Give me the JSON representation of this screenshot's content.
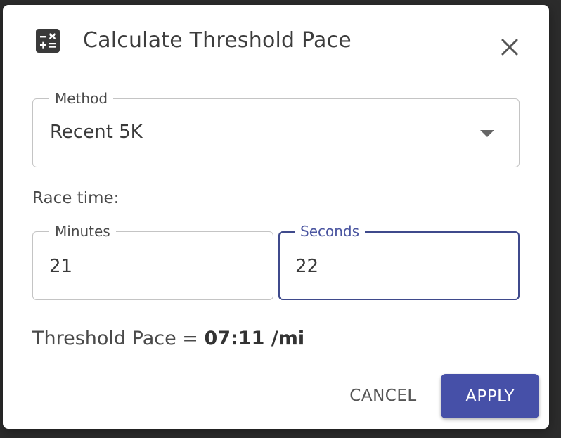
{
  "dialog": {
    "title": "Calculate Threshold Pace",
    "title_icon": "calculator-icon",
    "close_icon": "close-icon"
  },
  "method": {
    "label": "Method",
    "value": "Recent 5K"
  },
  "race_time": {
    "label": "Race time:",
    "minutes": {
      "label": "Minutes",
      "value": "21"
    },
    "seconds": {
      "label": "Seconds",
      "value": "22"
    }
  },
  "result": {
    "prefix": "Threshold Pace = ",
    "value": "07:11 /mi"
  },
  "actions": {
    "cancel_label": "CANCEL",
    "apply_label": "APPLY"
  },
  "colors": {
    "accent": "#4650a8",
    "focus_border": "#3f4a8c",
    "text": "#3d3d3d"
  }
}
